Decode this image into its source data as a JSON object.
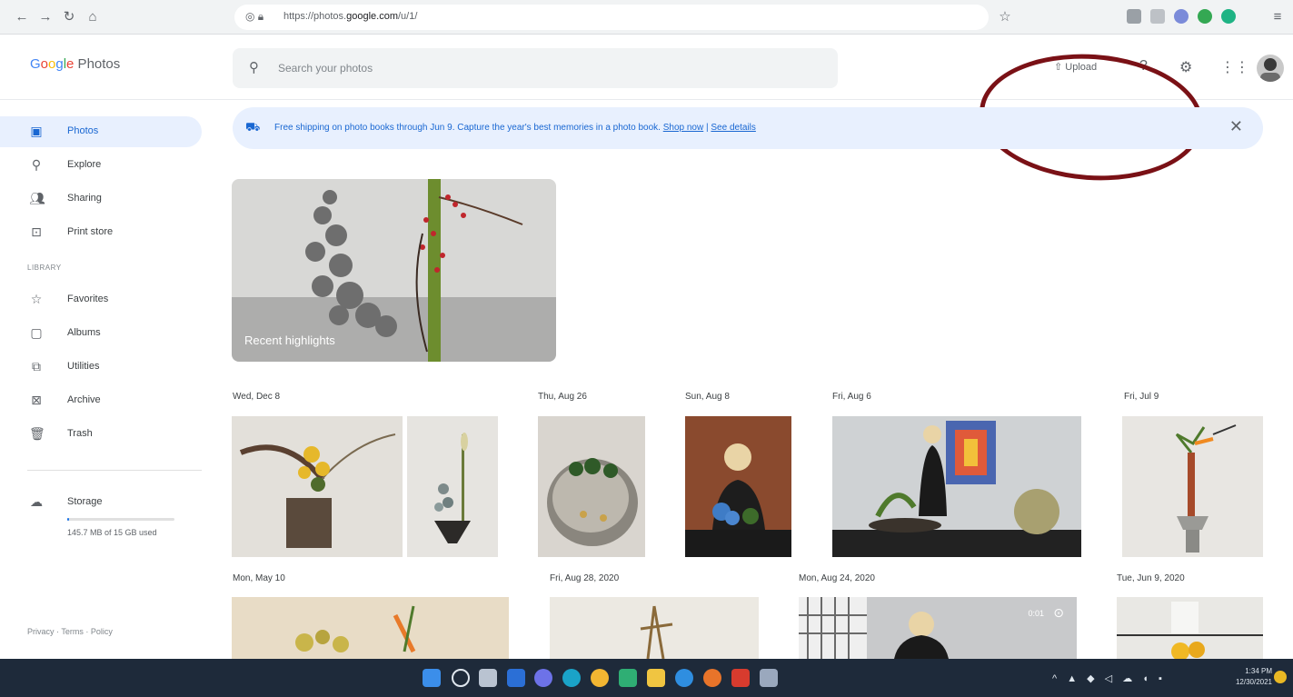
{
  "browser": {
    "url_prefix": "https://photos.",
    "url_domain": "google.com",
    "url_suffix": "/u/1/",
    "icons": [
      "back-icon",
      "forward-icon",
      "reload-icon",
      "home-icon",
      "lock-icon",
      "star-icon"
    ]
  },
  "header": {
    "logo": {
      "g1": "G",
      "g2": "o",
      "g3": "o",
      "g4": "g",
      "g5": "l",
      "g6": "e",
      "rest": " Photos"
    },
    "search_placeholder": "Search your photos",
    "upload_label": "Upload",
    "icons": [
      "upload-icon",
      "help-icon",
      "settings-icon",
      "apps-grid-icon"
    ]
  },
  "sidebar": {
    "items": [
      {
        "label": "Photos",
        "icon": "photo-icon",
        "active": true
      },
      {
        "label": "Explore",
        "icon": "search-icon"
      },
      {
        "label": "Sharing",
        "icon": "people-icon"
      },
      {
        "label": "Print store",
        "icon": "bag-icon"
      }
    ],
    "library_heading": "LIBRARY",
    "library": [
      {
        "label": "Favorites",
        "icon": "star-icon"
      },
      {
        "label": "Albums",
        "icon": "album-icon"
      },
      {
        "label": "Utilities",
        "icon": "utilities-icon"
      },
      {
        "label": "Archive",
        "icon": "archive-icon"
      },
      {
        "label": "Trash",
        "icon": "trash-icon"
      }
    ],
    "storage": {
      "label": "Storage",
      "usage": "145.7 MB of 15 GB used",
      "fraction_used": 0.01
    },
    "footer": "Privacy · Terms · Policy"
  },
  "banner": {
    "text": "Free shipping on photo books through Jun 9. Capture the year's best memories in a photo book.",
    "shop_now": "Shop now",
    "separator": "|",
    "see_details": "See details"
  },
  "highlights": {
    "label": "Recent highlights"
  },
  "groups": [
    {
      "date": "Wed, Dec 8"
    },
    {
      "date": "Thu, Aug 26"
    },
    {
      "date": "Sun, Aug 8"
    },
    {
      "date": "Fri, Aug 6"
    },
    {
      "date": "Fri, Jul 9"
    },
    {
      "date": "Mon, May 10"
    },
    {
      "date": "Fri, Aug 28, 2020"
    },
    {
      "date": "Mon, Aug 24, 2020"
    },
    {
      "date": "Tue, Jun 9, 2020"
    }
  ],
  "video_duration": "0:01",
  "taskbar": {
    "time": "1:34 PM",
    "date": "12/30/2021",
    "tray": "^ ▲ ◆ ◁ ☁ ◖ ▪"
  },
  "colors": {
    "accent": "#1967d2",
    "banner_bg": "#e8f0fe",
    "annotation": "#7a1116",
    "taskbar": "#1e2a3a"
  }
}
